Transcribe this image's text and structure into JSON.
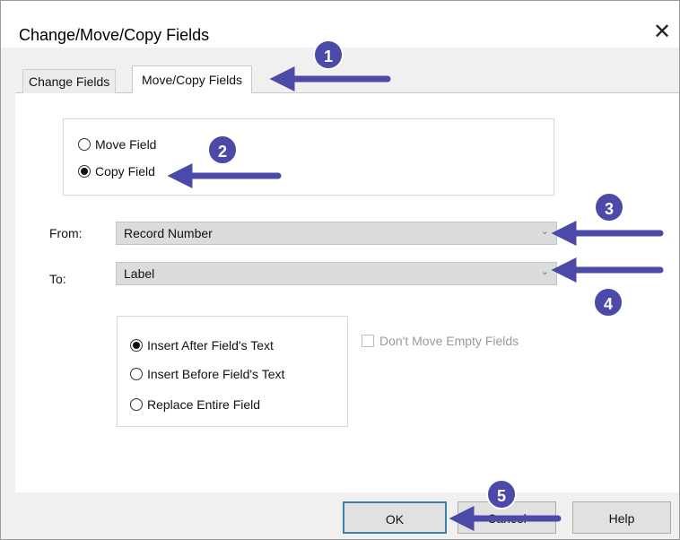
{
  "dialog": {
    "title": "Change/Move/Copy Fields",
    "close_symbol": "✕"
  },
  "tabs": [
    {
      "label": "Change Fields",
      "active": false
    },
    {
      "label": "Move/Copy Fields",
      "active": true
    }
  ],
  "mode": {
    "options": [
      {
        "label": "Move Field",
        "selected": false
      },
      {
        "label": "Copy Field",
        "selected": true
      }
    ]
  },
  "from": {
    "label": "From:",
    "value": "Record Number"
  },
  "to": {
    "label": "To:",
    "value": "Label"
  },
  "insert_options": [
    {
      "label": "Insert After Field's Text",
      "selected": true
    },
    {
      "label": "Insert Before Field's Text",
      "selected": false
    },
    {
      "label": "Replace Entire Field",
      "selected": false
    }
  ],
  "dont_move_empty": {
    "label": "Don't Move Empty Fields",
    "checked": false,
    "enabled": false
  },
  "buttons": {
    "ok": "OK",
    "cancel": "Cancel",
    "help": "Help"
  },
  "annotations": [
    "1",
    "2",
    "3",
    "4",
    "5"
  ],
  "colors": {
    "annotation": "#4b4aa8",
    "default_button_border": "#3c7fb1"
  },
  "icons": {
    "close": "close-icon",
    "dropdown": "chevron-down-icon"
  }
}
